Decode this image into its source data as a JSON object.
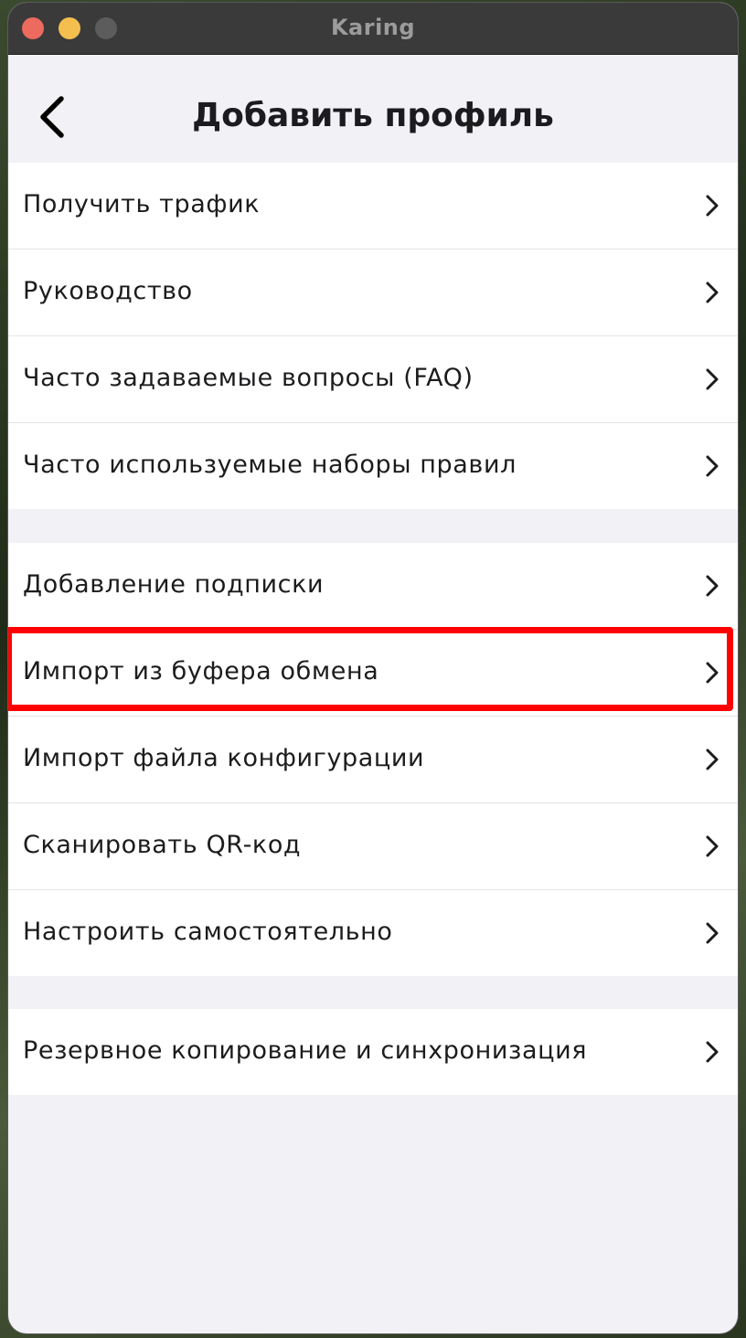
{
  "window": {
    "title": "Karing",
    "traffic_colors": {
      "close": "#ed6a5e",
      "minimize": "#f4bf4f",
      "zoom": "#5c5c5c"
    }
  },
  "header": {
    "title": "Добавить профиль",
    "back_icon": "chevron-left-icon"
  },
  "groups": [
    {
      "items": [
        {
          "label": "Получить трафик"
        },
        {
          "label": "Руководство"
        },
        {
          "label": "Часто задаваемые вопросы (FAQ)"
        },
        {
          "label": "Часто используемые наборы правил"
        }
      ]
    },
    {
      "items": [
        {
          "label": "Добавление подписки"
        },
        {
          "label": "Импорт из буфера обмена",
          "highlighted": true
        },
        {
          "label": "Импорт файла конфигурации"
        },
        {
          "label": "Сканировать QR-код"
        },
        {
          "label": "Настроить самостоятельно"
        }
      ]
    },
    {
      "items": [
        {
          "label": "Резервное копирование и синхронизация"
        }
      ]
    }
  ],
  "colors": {
    "highlight": "#ff0000",
    "background": "#f2f1f6",
    "row_bg": "#ffffff"
  }
}
